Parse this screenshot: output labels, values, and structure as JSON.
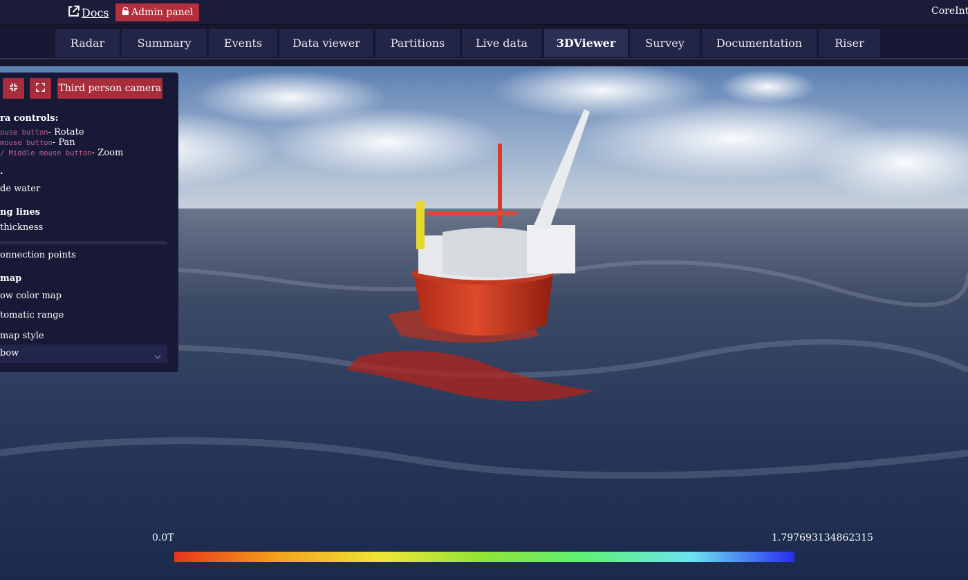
{
  "topbar": {
    "docs_label": "Docs",
    "admin_label": "Admin panel",
    "brand": "CoreInte"
  },
  "tabs": [
    {
      "label": "Radar",
      "active": false
    },
    {
      "label": "Summary",
      "active": false
    },
    {
      "label": "Events",
      "active": false
    },
    {
      "label": "Data viewer",
      "active": false
    },
    {
      "label": "Partitions",
      "active": false
    },
    {
      "label": "Live data",
      "active": false
    },
    {
      "label": "3DViewer",
      "active": true
    },
    {
      "label": "Survey",
      "active": false
    },
    {
      "label": "Documentation",
      "active": false
    },
    {
      "label": "Riser",
      "active": false
    }
  ],
  "panel": {
    "camera_button": "Third person camera",
    "controls_title": "ra controls:",
    "controls": [
      {
        "key": "ouse button",
        "action": "- Rotate"
      },
      {
        "key": "mouse button",
        "action": "- Pan"
      },
      {
        "key": " / Middle mouse button",
        "action": "- Zoom"
      }
    ],
    "water_section": ".",
    "hide_water": "de water",
    "lines_title": "ng lines",
    "thickness_label": "thickness",
    "connection_points": "onnection points",
    "colormap_title": "map",
    "show_color_map": "ow color map",
    "automatic_range": "tomatic range",
    "map_style_label": "map style",
    "map_style_value": "bow"
  },
  "legend": {
    "min": "0.0T",
    "max": "1.7976931348623157e",
    "colors": [
      "#e8341c",
      "#f3a21c",
      "#efe535",
      "#8ee637",
      "#5ff07a",
      "#6ee3f0",
      "#2a2cf0"
    ]
  }
}
